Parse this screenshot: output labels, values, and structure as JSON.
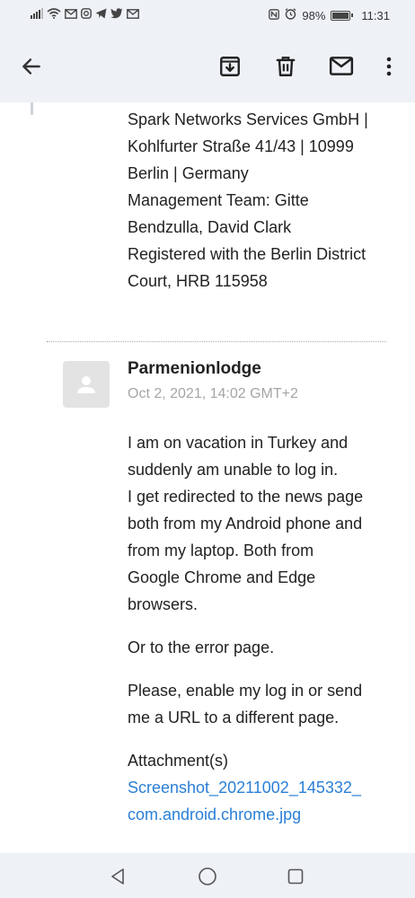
{
  "status_bar": {
    "time": "11:31",
    "battery": "98%",
    "battery_level": 0.98,
    "left_icons": [
      "signal-icon",
      "wifi-icon",
      "gmail-icon",
      "instagram-icon",
      "telegram-icon",
      "twitter-icon",
      "gmail-icon"
    ],
    "right_icons": [
      "nfc-icon",
      "alarm-icon",
      "battery-icon"
    ]
  },
  "app_bar": {
    "actions": [
      "back-icon",
      "archive-icon",
      "delete-icon",
      "mark-unread-icon",
      "more-icon"
    ]
  },
  "signature": {
    "lines": [
      "Spark Networks Services GmbH |",
      "Kohlfurter Straße 41/43 | 10999",
      "Berlin | Germany",
      "Management Team: Gitte",
      "Bendzulla, David Clark",
      "Registered with the Berlin District",
      "Court, HRB 115958"
    ]
  },
  "message": {
    "sender": "Parmenionlodge",
    "date": "Oct 2, 2021, 14:02 GMT+2",
    "paragraph1_lines": [
      "I am on vacation in Turkey and",
      "suddenly am unable to log in.",
      "I get redirected to the news page",
      "both from my Android phone and",
      "from my laptop. Both from",
      "Google Chrome and Edge",
      "browsers."
    ],
    "paragraph2": "Or to the error page.",
    "paragraph3_lines": [
      "Please, enable my log in or send",
      "me a URL to a different page."
    ],
    "attachment_label": "Attachment(s)",
    "attachment_lines": [
      "Screenshot_20211002_145332_",
      "com.android.chrome.jpg"
    ]
  },
  "nav_bar": {
    "buttons": [
      "back-triangle-icon",
      "home-circle-icon",
      "recents-square-icon"
    ]
  },
  "colors": {
    "bar_background": "#eef1f6",
    "link": "#2a7fd6",
    "date_gray": "#a5a5a5"
  }
}
